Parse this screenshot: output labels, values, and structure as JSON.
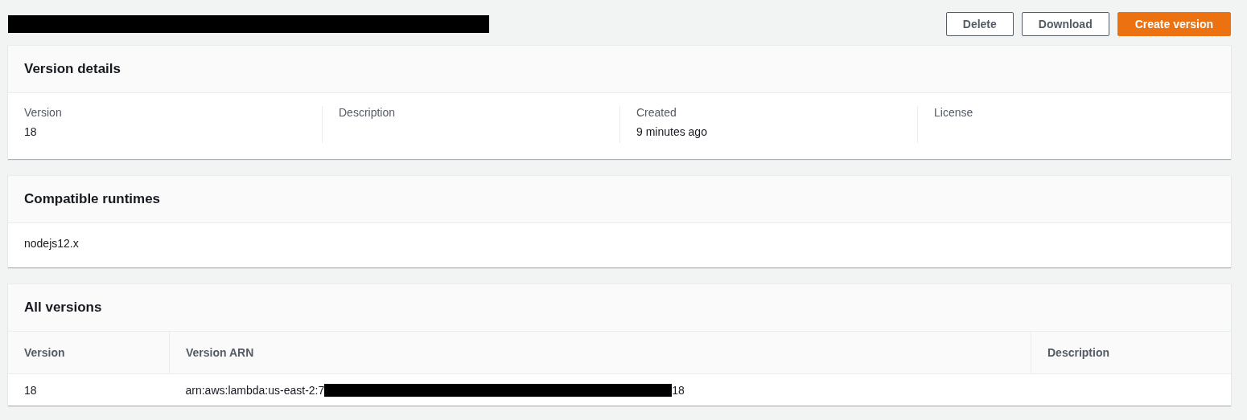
{
  "header": {
    "title": {
      "redacted": true
    },
    "buttons": [
      {
        "label": "Delete",
        "kind": "normal"
      },
      {
        "label": "Download",
        "kind": "normal"
      },
      {
        "label": "Create version",
        "kind": "primary"
      }
    ]
  },
  "version_details": {
    "title": "Version details",
    "fields": [
      {
        "label": "Version",
        "value": "18"
      },
      {
        "label": "Description"
      },
      {
        "label": "Created",
        "value": "9 minutes ago"
      },
      {
        "label": "License"
      }
    ]
  },
  "compatible_runtimes": {
    "title": "Compatible runtimes",
    "items": [
      "nodejs12.x"
    ]
  },
  "all_versions": {
    "title": "All versions",
    "table": {
      "columns": [
        "Version",
        "Version ARN",
        "Description"
      ],
      "rows": [
        {
          "cells": [
            [
              {
                "kind": "text",
                "text": "18"
              }
            ],
            [
              {
                "kind": "text",
                "text": "arn:aws:lambda:us-east-2:7"
              },
              {
                "kind": "redaction"
              },
              {
                "kind": "text",
                "text": "18"
              }
            ],
            []
          ]
        }
      ]
    }
  }
}
